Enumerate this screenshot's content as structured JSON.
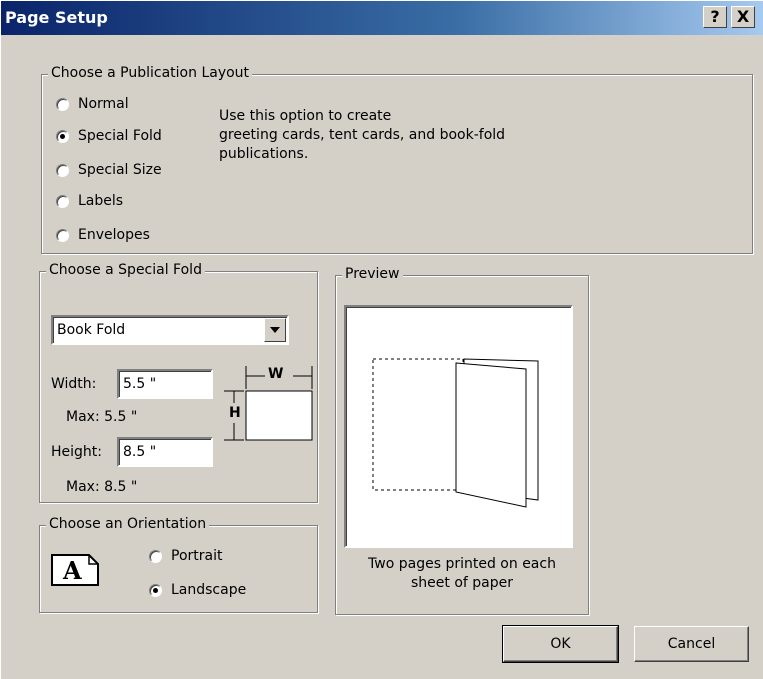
{
  "dialog": {
    "title": "Page Setup",
    "help_label": "?",
    "close_label": "X"
  },
  "layout_group": {
    "legend": "Choose a Publication Layout",
    "options": [
      {
        "label": "Normal",
        "checked": false
      },
      {
        "label": "Special Fold",
        "checked": true
      },
      {
        "label": "Special Size",
        "checked": false
      },
      {
        "label": "Labels",
        "checked": false
      },
      {
        "label": "Envelopes",
        "checked": false
      }
    ],
    "description_lines": [
      "Use this option to create",
      "greeting cards, tent cards, and book-fold",
      "publications."
    ]
  },
  "fold_group": {
    "legend": "Choose a Special Fold",
    "fold_type": "Book Fold",
    "width_label": "Width:",
    "width_value": "5.5 \"",
    "width_max": "Max: 5.5 \"",
    "height_label": "Height:",
    "height_value": "8.5 \"",
    "height_max": "Max: 8.5 \"",
    "dim_w": "W",
    "dim_h": "H"
  },
  "orientation_group": {
    "legend": "Choose an Orientation",
    "icon_letter": "A",
    "options": [
      {
        "label": "Portrait",
        "checked": false
      },
      {
        "label": "Landscape",
        "checked": true
      }
    ]
  },
  "preview_group": {
    "legend": "Preview",
    "caption_lines": [
      "Two pages printed on each",
      "sheet of paper"
    ]
  },
  "buttons": {
    "ok": "OK",
    "cancel": "Cancel"
  }
}
